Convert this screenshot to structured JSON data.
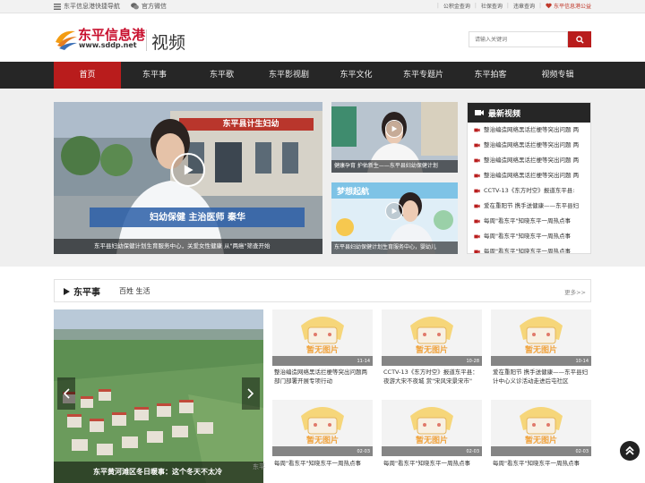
{
  "topbar": {
    "nav_link": "东平信息港快捷导航",
    "wechat": "官方微信",
    "links": [
      "公积金查询",
      "社保查询",
      "违章查询"
    ],
    "charity": "东平信息港公益"
  },
  "header": {
    "logo_text": "东平信息港",
    "logo_url": "www.sddp.net",
    "section_title": "视频",
    "search_placeholder": "请输入关键词"
  },
  "nav": {
    "items": [
      "首页",
      "东平事",
      "东平歌",
      "东平影视剧",
      "东平文化",
      "东平专题片",
      "东平拍客",
      "视频专辑"
    ]
  },
  "featured": {
    "main_caption": "东平县妇幼保健计划生育服务中心，关爱女性健康 从\"两癌\"筛查开始",
    "main_sign": "妇幼保健 主治医师 秦华",
    "main_building_sign": "东平县计生妇幼",
    "side1_caption": "健康孕育 护佑新生——东平县妇幼保健计划",
    "side2_caption": "东平县妇幼保健计划生育服务中心，婴幼儿",
    "side2_banner": "梦想起航"
  },
  "latest": {
    "title": "最新视频",
    "items": [
      "整治编造网络黑话拦梗等突出问题 两",
      "整治编造网络黑话拦梗等突出问题 两",
      "整治编造网络黑话拦梗等突出问题 两",
      "整治编造网络黑话拦梗等突出问题 两",
      "CCTV-13《东方时空》报道东平县:",
      "爱在重阳节 携手送健康——东平县妇",
      "每周\"看东平\"知晓东平一周热点事",
      "每周\"看东平\"知晓东平一周热点事",
      "每周\"看东平\"知晓东平一周热点事"
    ]
  },
  "section": {
    "title": "东平事",
    "subtitle": "百姓 生活",
    "more": "更多>>",
    "slide_caption": "东平黄河滩区冬日暖事：这个冬天不太冷",
    "slide_watermark": "东平信",
    "placeholder_text": "暂无图片",
    "cards": [
      {
        "date": "11-14",
        "title": "整治编造网络黑话拦梗等突出问题两部门部署开展专项行动"
      },
      {
        "date": "10-28",
        "title": "CCTV-13《东方时空》报道东平县：夜游大宋不夜城 赏\"宋风宋景宋市\""
      },
      {
        "date": "10-14",
        "title": "爱在重阳节 携手送健康——东平县妇计中心义诊活动走进后屯社区"
      },
      {
        "date": "02-03",
        "title": "每周\"看东平\"知晓东平一周热点事"
      },
      {
        "date": "02-03",
        "title": "每周\"看东平\"知晓东平一周热点事"
      },
      {
        "date": "02-03",
        "title": "每周\"看东平\"知晓东平一周热点事"
      }
    ]
  },
  "colors": {
    "accent": "#b91c1c",
    "nav_bg": "#262626",
    "logo_red": "#c8102e"
  },
  "icons": [
    "list-icon",
    "wechat-icon",
    "search-icon",
    "video-icon",
    "play-icon",
    "chevron-left-icon",
    "chevron-right-icon",
    "back-to-top-icon"
  ]
}
